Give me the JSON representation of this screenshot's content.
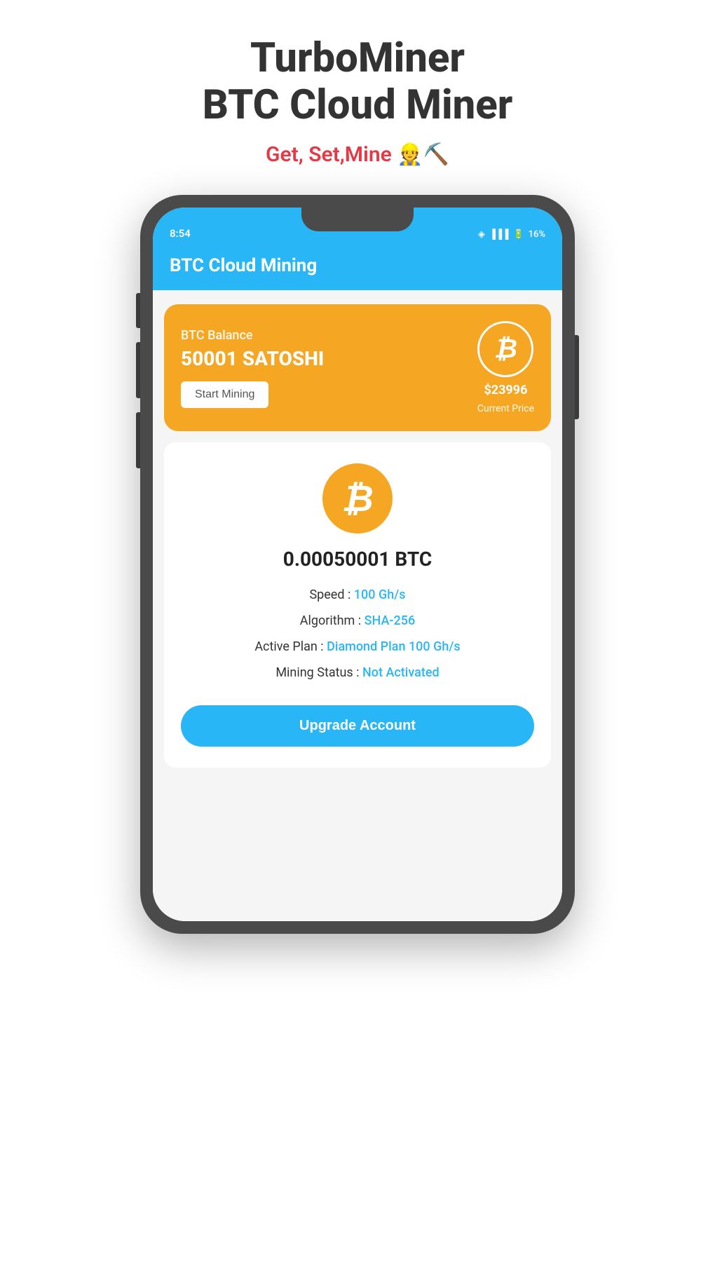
{
  "header": {
    "title_line1": "TurboMiner",
    "title_line2": "BTC Cloud Miner",
    "tagline_text": "Get, Set,Mine",
    "tagline_emojis": "👷⛏️"
  },
  "status_bar": {
    "time": "8:54",
    "battery": "16%",
    "signal": "●●●"
  },
  "app_bar": {
    "title": "BTC Cloud Mining"
  },
  "balance_card": {
    "label": "BTC Balance",
    "amount": "50001 SATOSHI",
    "start_mining_label": "Start Mining",
    "btc_symbol": "₿",
    "price": "$23996",
    "price_label": "Current Price"
  },
  "mining_info": {
    "btc_symbol": "₿",
    "btc_value": "0.00050001 BTC",
    "speed_label": "Speed : ",
    "speed_value": "100 Gh/s",
    "algorithm_label": "Algorithm : ",
    "algorithm_value": "SHA-256",
    "active_plan_label": "Active Plan : ",
    "active_plan_value": "Diamond Plan 100 Gh/s",
    "mining_status_label": "Mining Status : ",
    "mining_status_value": "Not Activated",
    "upgrade_button_label": "Upgrade Account"
  },
  "colors": {
    "accent_blue": "#29b6f6",
    "accent_orange": "#f5a623",
    "text_dark": "#333333",
    "text_red": "#e63946",
    "white": "#ffffff"
  }
}
